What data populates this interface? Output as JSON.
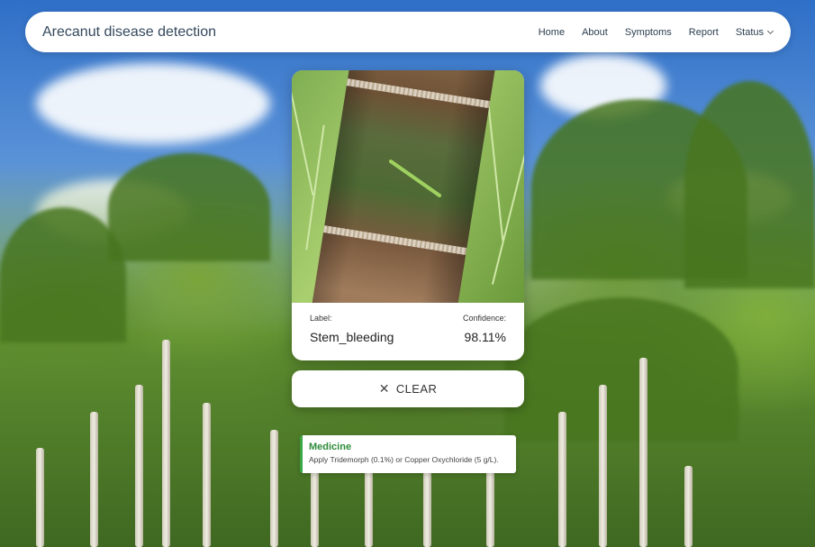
{
  "navbar": {
    "brand": "Arecanut disease detection",
    "links": [
      "Home",
      "About",
      "Symptoms",
      "Report",
      "Status"
    ]
  },
  "result": {
    "label_caption": "Label:",
    "label_value": "Stem_bleeding",
    "confidence_caption": "Confidence:",
    "confidence_value": "98.11%"
  },
  "clear_button": {
    "label": "CLEAR",
    "icon": "close-icon"
  },
  "medicine": {
    "title": "Medicine",
    "text": "Apply Tridemorph (0.1%) or Copper Oxychloride (5 g/L)."
  },
  "colors": {
    "navbar_bg": "#ffffff",
    "brand_text": "#34495e",
    "medicine_accent": "#3ca544"
  }
}
